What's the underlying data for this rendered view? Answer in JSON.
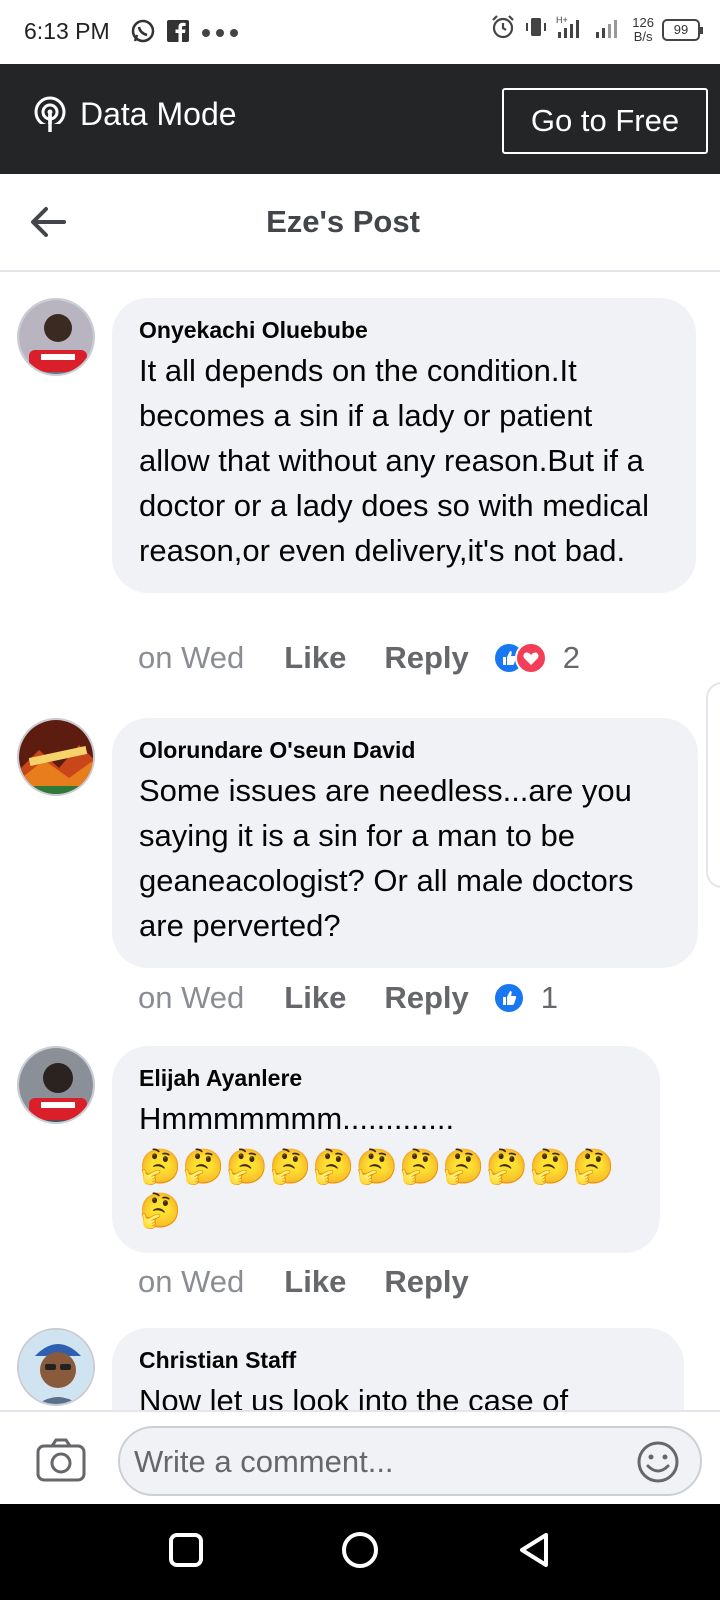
{
  "status_bar": {
    "time": "6:13 PM",
    "net_speed_value": "126",
    "net_speed_unit": "B/s",
    "battery": "99",
    "icons": [
      "whatsapp-icon",
      "facebook-icon",
      "more-dots-icon",
      "alarm-icon",
      "vibrate-icon",
      "signal-icon",
      "signal-icon",
      "battery-icon"
    ]
  },
  "data_bar": {
    "label": "Data Mode",
    "button": "Go to Free"
  },
  "header": {
    "title": "Eze's Post",
    "back_icon": "arrow-left-icon"
  },
  "comments": [
    {
      "author": "Onyekachi Oluebube",
      "text": "It all depends on the condition.It becomes a sin if a lady or patient allow that without any reason.But if a doctor or a lady does so with medical reason,or even delivery,it's not bad.",
      "time": "on Wed",
      "like_label": "Like",
      "reply_label": "Reply",
      "reactions": [
        "like",
        "love"
      ],
      "reaction_count": "2"
    },
    {
      "author": "Olorundare O'seun David",
      "text": "Some issues are needless...are you saying it is a sin for a man to be geaneacologist? Or all male doctors are perverted?",
      "time": "on Wed",
      "like_label": "Like",
      "reply_label": "Reply",
      "reactions": [
        "like"
      ],
      "reaction_count": "1"
    },
    {
      "author": "Elijah Ayanlere",
      "text": "Hmmmmmmm.............",
      "emojis": "🤔🤔🤔🤔🤔🤔🤔🤔🤔🤔🤔🤔",
      "time": "on Wed",
      "like_label": "Like",
      "reply_label": "Reply"
    },
    {
      "author": "Christian Staff",
      "text": "Now let us look into the case of"
    }
  ],
  "composer": {
    "placeholder": "Write a comment...",
    "camera_icon": "camera-icon",
    "emoji_icon": "smiley-icon"
  },
  "colors": {
    "data_bar_bg": "#242526",
    "bubble_bg": "#f0f2f5",
    "like_blue": "#1877f2",
    "love_red": "#f33e58",
    "meta_gray": "#65676b"
  }
}
